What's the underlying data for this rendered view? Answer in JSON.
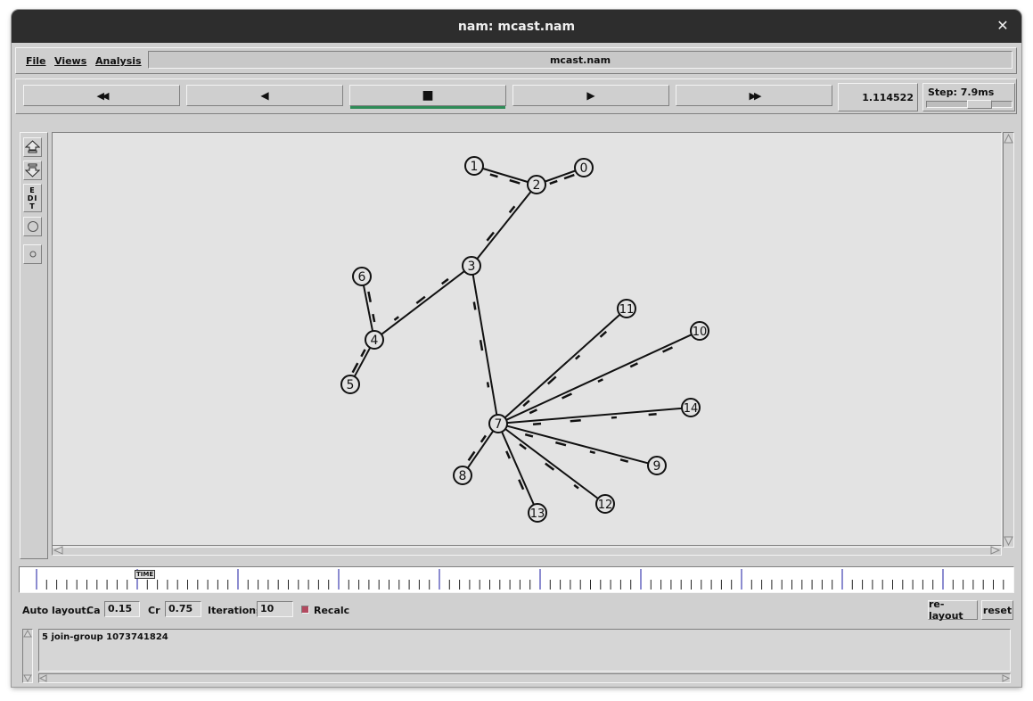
{
  "window": {
    "title": "nam: mcast.nam",
    "close_glyph": "✕"
  },
  "menu": {
    "items": [
      "File",
      "Views",
      "Analysis"
    ],
    "file_title": "mcast.nam"
  },
  "toolbar": {
    "rewind_icon": "rewind-icon",
    "back_icon": "play-backward-icon",
    "stop_icon": "stop-icon",
    "play_icon": "play-icon",
    "fastforward_icon": "fast-forward-icon",
    "rewind_glyph": "◀◀",
    "back_glyph": "◀",
    "stop_glyph": "■",
    "play_glyph": "▶",
    "fastforward_glyph": "▶▶",
    "active_color": "#2e8b57",
    "current_time": "1.114522",
    "step_label": "Step: 7.9ms"
  },
  "left_tools": {
    "edit_label": "EDIT"
  },
  "network": {
    "nodes": [
      {
        "id": "0"
      },
      {
        "id": "1"
      },
      {
        "id": "2"
      },
      {
        "id": "3"
      },
      {
        "id": "4"
      },
      {
        "id": "5"
      },
      {
        "id": "6"
      },
      {
        "id": "7"
      },
      {
        "id": "8"
      },
      {
        "id": "9"
      },
      {
        "id": "10"
      },
      {
        "id": "11"
      },
      {
        "id": "12"
      },
      {
        "id": "13"
      },
      {
        "id": "14"
      }
    ],
    "links": [
      [
        "1",
        "2"
      ],
      [
        "2",
        "0"
      ],
      [
        "2",
        "3"
      ],
      [
        "3",
        "4"
      ],
      [
        "3",
        "7"
      ],
      [
        "4",
        "6"
      ],
      [
        "4",
        "5"
      ],
      [
        "7",
        "11"
      ],
      [
        "7",
        "10"
      ],
      [
        "7",
        "14"
      ],
      [
        "7",
        "9"
      ],
      [
        "7",
        "12"
      ],
      [
        "7",
        "13"
      ],
      [
        "7",
        "8"
      ]
    ]
  },
  "timeline": {
    "marker_label": "TIME"
  },
  "autolayout": {
    "label": "Auto layout:",
    "ca_label": "Ca",
    "ca_value": "0.15",
    "cr_label": "Cr",
    "cr_value": "0.75",
    "iterations_label": "Iterations",
    "iterations_value": "10",
    "recalc_label": "Recalc",
    "recalc_checked": true,
    "relayout_label": "re-layout",
    "reset_label": "reset"
  },
  "log": {
    "text": "5 join-group 1073741824"
  }
}
